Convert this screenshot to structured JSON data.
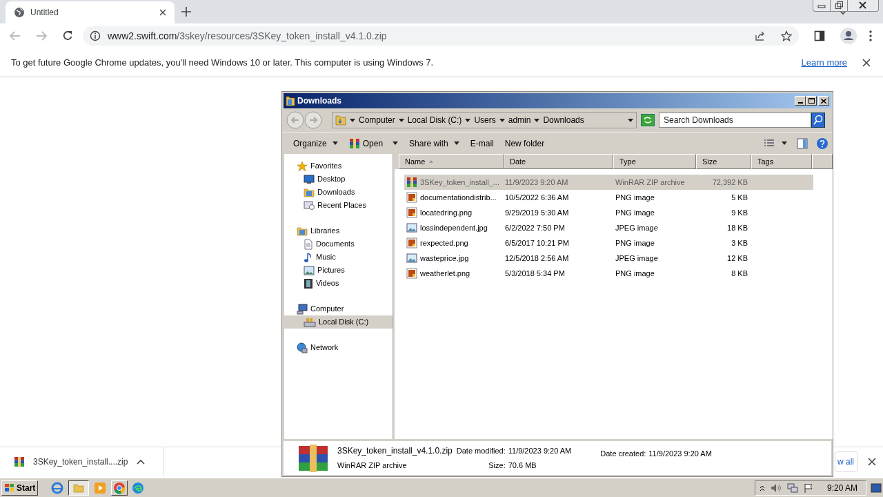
{
  "browser": {
    "tabs": [
      {
        "title": "Untitled",
        "selected": true
      }
    ],
    "address": {
      "host": "www2.swift.com",
      "path": "/3skey/resources/3SKey_token_install_v4.1.0.zip"
    },
    "infobar": {
      "message": "To get future Google Chrome updates, you'll need Windows 10 or later. This computer is using Windows 7.",
      "link": "Learn more"
    },
    "download_bar": {
      "file": "3SKey_token_install....zip",
      "show_all": "w all"
    }
  },
  "explorer": {
    "title": "Downloads",
    "breadcrumb": [
      "Computer",
      "Local Disk (C:)",
      "Users",
      "admin",
      "Downloads"
    ],
    "search": {
      "placeholder": "Search Downloads"
    },
    "toolbar": [
      {
        "label": "Organize",
        "kind": "menu"
      },
      {
        "label": "Open",
        "kind": "split"
      },
      {
        "label": "Share with",
        "kind": "menu"
      },
      {
        "label": "E-mail",
        "kind": "plain"
      },
      {
        "label": "New folder",
        "kind": "plain"
      }
    ],
    "nav": [
      {
        "label": "Favorites",
        "kind": "favorites",
        "selected": false,
        "children": [
          {
            "label": "Desktop",
            "kind": "desktop",
            "selected": false
          },
          {
            "label": "Downloads",
            "kind": "folder",
            "selected": false
          },
          {
            "label": "Recent Places",
            "kind": "recent",
            "selected": false
          }
        ]
      },
      {
        "label": "Libraries",
        "kind": "folder",
        "selected": false,
        "children": [
          {
            "label": "Documents",
            "kind": "document",
            "selected": false
          },
          {
            "label": "Music",
            "kind": "music",
            "selected": false
          },
          {
            "label": "Pictures",
            "kind": "image",
            "selected": false
          },
          {
            "label": "Videos",
            "kind": "video",
            "selected": false
          }
        ]
      },
      {
        "label": "Computer",
        "kind": "computer",
        "selected": false,
        "children": [
          {
            "label": "Local Disk (C:)",
            "kind": "disk",
            "selected": true
          }
        ]
      },
      {
        "label": "Network",
        "kind": "network",
        "selected": false
      }
    ],
    "columns": [
      "Name",
      "Date",
      "Type",
      "Size",
      "Tags"
    ],
    "files": [
      {
        "name": "3SKey_token_install_...",
        "date": "11/9/2023 9:20 AM",
        "type": "WinRAR ZIP archive",
        "size": "72,392 KB",
        "kind": "archive",
        "selected": true
      },
      {
        "name": "documentationdistrib...",
        "date": "10/5/2022 6:36 AM",
        "type": "PNG image",
        "size": "5 KB",
        "kind": "png",
        "selected": false
      },
      {
        "name": "locatedring.png",
        "date": "9/29/2019 5:30 AM",
        "type": "PNG image",
        "size": "9 KB",
        "kind": "png",
        "selected": false
      },
      {
        "name": "lossindependent.jpg",
        "date": "6/2/2022 7:50 PM",
        "type": "JPEG image",
        "size": "18 KB",
        "kind": "jpg",
        "selected": false
      },
      {
        "name": "rexpected.png",
        "date": "6/5/2017 10:21 PM",
        "type": "PNG image",
        "size": "3 KB",
        "kind": "png",
        "selected": false
      },
      {
        "name": "wasteprice.jpg",
        "date": "12/5/2018 2:56 AM",
        "type": "JPEG image",
        "size": "12 KB",
        "kind": "jpg",
        "selected": false
      },
      {
        "name": "weatherlet.png",
        "date": "5/3/2018 5:34 PM",
        "type": "PNG image",
        "size": "8 KB",
        "kind": "png",
        "selected": false
      }
    ],
    "details": {
      "name": "3SKey_token_install_v4.1.0.zip",
      "type": "WinRAR ZIP archive",
      "modified_label": "Date modified:",
      "modified": "11/9/2023 9:20 AM",
      "size_label": "Size:",
      "size": "70.6 MB",
      "created_label": "Date created:",
      "created": "11/9/2023 9:20 AM"
    }
  },
  "taskbar": {
    "start": "Start",
    "clock": "9:20 AM"
  }
}
